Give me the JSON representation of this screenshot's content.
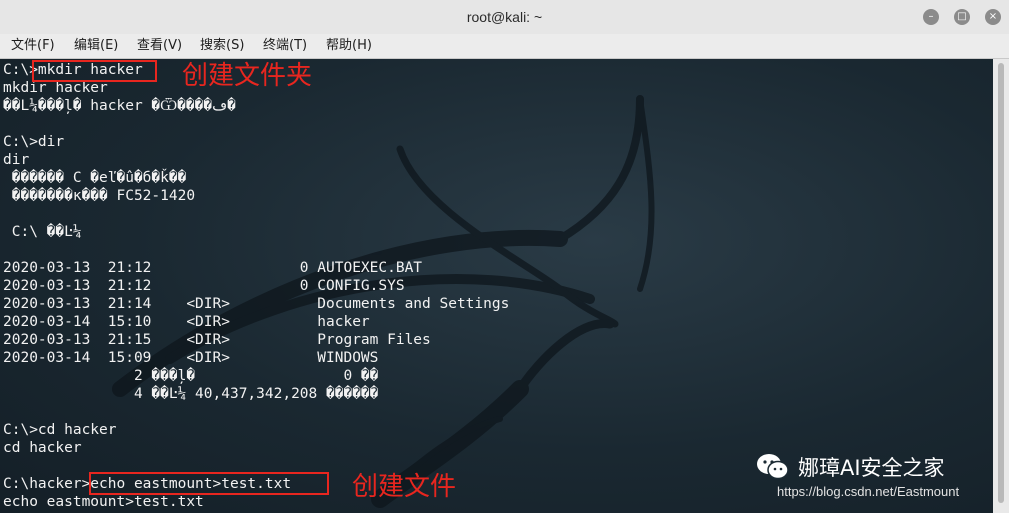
{
  "window": {
    "title": "root@kali: ~",
    "minimize_glyph": "–",
    "maximize_glyph": "□",
    "close_glyph": "×"
  },
  "menu": [
    "文件(F)",
    "编辑(E)",
    "查看(V)",
    "搜索(S)",
    "终端(T)",
    "帮助(H)"
  ],
  "terminal_lines": [
    "C:\\>mkdir hacker",
    "mkdir hacker",
    "��L¼���ļ� hacker �Ѿ����ڡ�",
    "",
    "C:\\>dir",
    "dir",
    " ������ C �еľ�û�б�ǩ��",
    " �������к��� FC52-1420",
    "",
    " C:\\ ��Ŀ¼",
    "",
    "2020-03-13  21:12                 0 AUTOEXEC.BAT",
    "2020-03-13  21:12                 0 CONFIG.SYS",
    "2020-03-13  21:14    <DIR>          Documents and Settings",
    "2020-03-14  15:10    <DIR>          hacker",
    "2020-03-13  21:15    <DIR>          Program Files",
    "2020-03-14  15:09    <DIR>          WINDOWS",
    "               2 ���ļ�                 0 ��",
    "               4 ��Ŀ¼ 40,437,342,208 ������",
    "",
    "C:\\>cd hacker",
    "cd hacker",
    "",
    "C:\\hacker>echo eastmount>test.txt",
    "echo eastmount>test.txt"
  ],
  "annotations": {
    "mkdir_note": "创建文件夹",
    "echo_note": "创建文件"
  },
  "watermark": {
    "account": "娜璋AI安全之家",
    "url": "https://blog.csdn.net/Eastmount"
  },
  "colors": {
    "annotation_red": "#e8261f",
    "terminal_text": "#f2f2f2"
  }
}
